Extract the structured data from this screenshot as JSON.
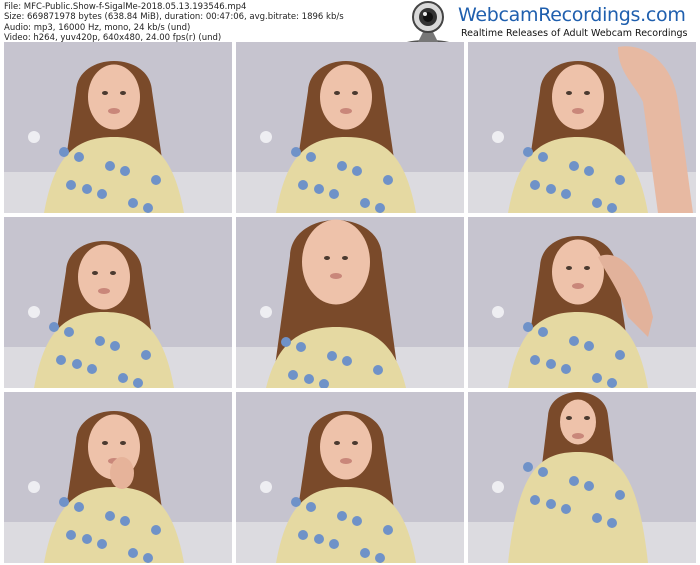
{
  "file_info": {
    "line1": "File: MFC-Public.Show-f-SigalMe-2018.05.13.193546.mp4",
    "line2": "Size: 669871978 bytes (638.84 MiB), duration: 00:47:06, avg.bitrate: 1896 kb/s",
    "line3": "Audio: mp3, 16000 Hz, mono, 24 kb/s (und)",
    "line4": "Video: h264, yuv420p, 640x480, 24.00 fps(r) (und)"
  },
  "logo": {
    "title": "WebcamRecordings.com",
    "tagline": "Realtime Releases of Adult Webcam Recordings",
    "icon": "webcam-icon",
    "brand_color": "#1f5fae"
  },
  "thumbnails": [
    {
      "index": 1,
      "pose": "face-center"
    },
    {
      "index": 2,
      "pose": "face-center"
    },
    {
      "index": 3,
      "pose": "hand-raised"
    },
    {
      "index": 4,
      "pose": "face-left"
    },
    {
      "index": 5,
      "pose": "close-up"
    },
    {
      "index": 6,
      "pose": "hand-in-hair"
    },
    {
      "index": 7,
      "pose": "hand-at-mouth"
    },
    {
      "index": 8,
      "pose": "face-center"
    },
    {
      "index": 9,
      "pose": "sitting-back"
    }
  ]
}
